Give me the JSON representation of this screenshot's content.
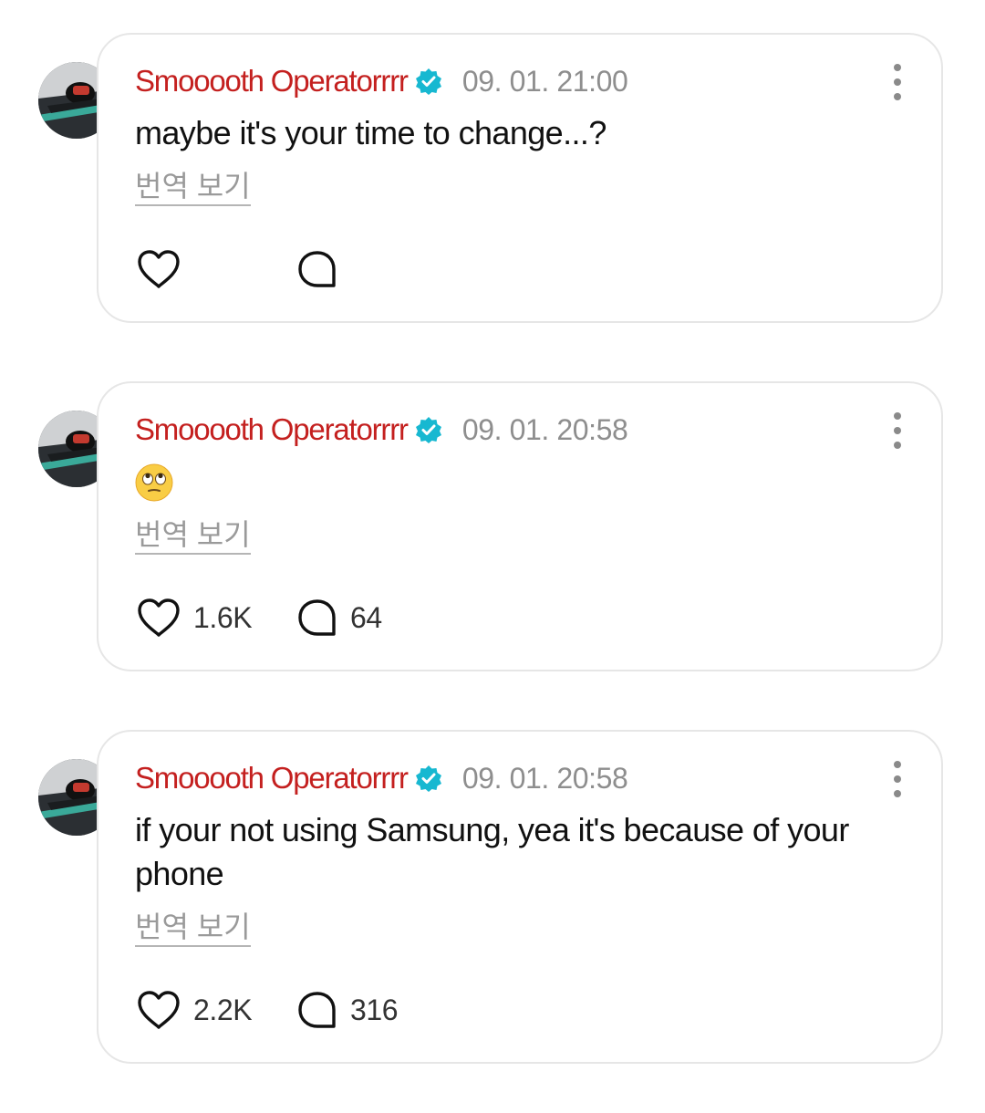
{
  "colors": {
    "username": "#c4201f",
    "verified_badge": "#17b8d1",
    "timestamp": "#8e8e8e",
    "bubble_border": "#e6e6e6"
  },
  "icons": {
    "like": "heart-outline-icon",
    "reply": "speech-bubble-outline-icon",
    "more": "vertical-ellipsis-icon",
    "verified": "verified-badge-icon"
  },
  "posts": [
    {
      "username": "Smooooth Operatorrrr",
      "timestamp": "09. 01. 21:00",
      "text": "maybe it's your time to change...?",
      "translate_label": "번역 보기",
      "likes": "",
      "replies": ""
    },
    {
      "username": "Smooooth Operatorrrr",
      "timestamp": "09. 01. 20:58",
      "emoji": "face-with-rolling-eyes",
      "translate_label": "번역 보기",
      "likes": "1.6K",
      "replies": "64"
    },
    {
      "username": "Smooooth Operatorrrr",
      "timestamp": "09. 01. 20:58",
      "text": "if your not using Samsung, yea it's because of your phone",
      "translate_label": "번역 보기",
      "likes": "2.2K",
      "replies": "316"
    }
  ]
}
